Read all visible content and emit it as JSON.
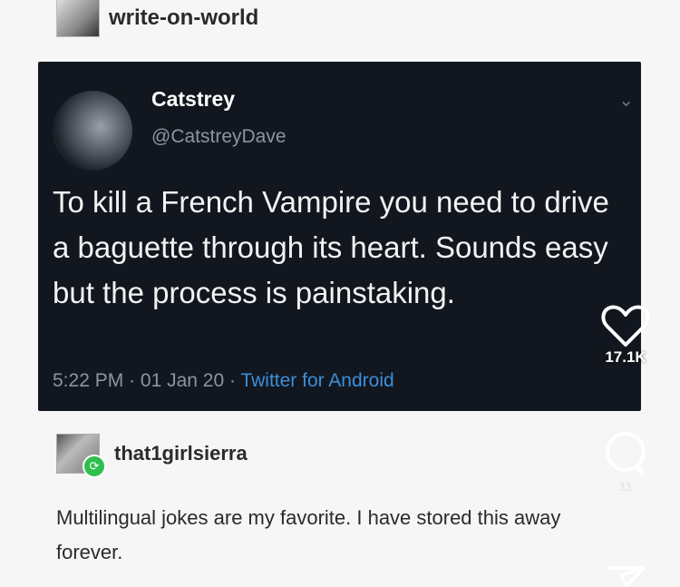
{
  "tumblr": {
    "username": "write-on-world"
  },
  "tweet": {
    "display_name": "Catstrey",
    "handle": "@CatstreyDave",
    "text": "To kill a French Vampire you need to drive a baguette through its heart. Sounds easy but the process is painstaking.",
    "time": "5:22 PM",
    "date": "01 Jan 20",
    "source": "Twitter for Android"
  },
  "reblog": {
    "username": "that1girlsierra",
    "comment": "Multilingual jokes are my favorite. I have stored this away forever."
  },
  "actions": {
    "like_count": "17.1K",
    "comment_count": "11"
  }
}
